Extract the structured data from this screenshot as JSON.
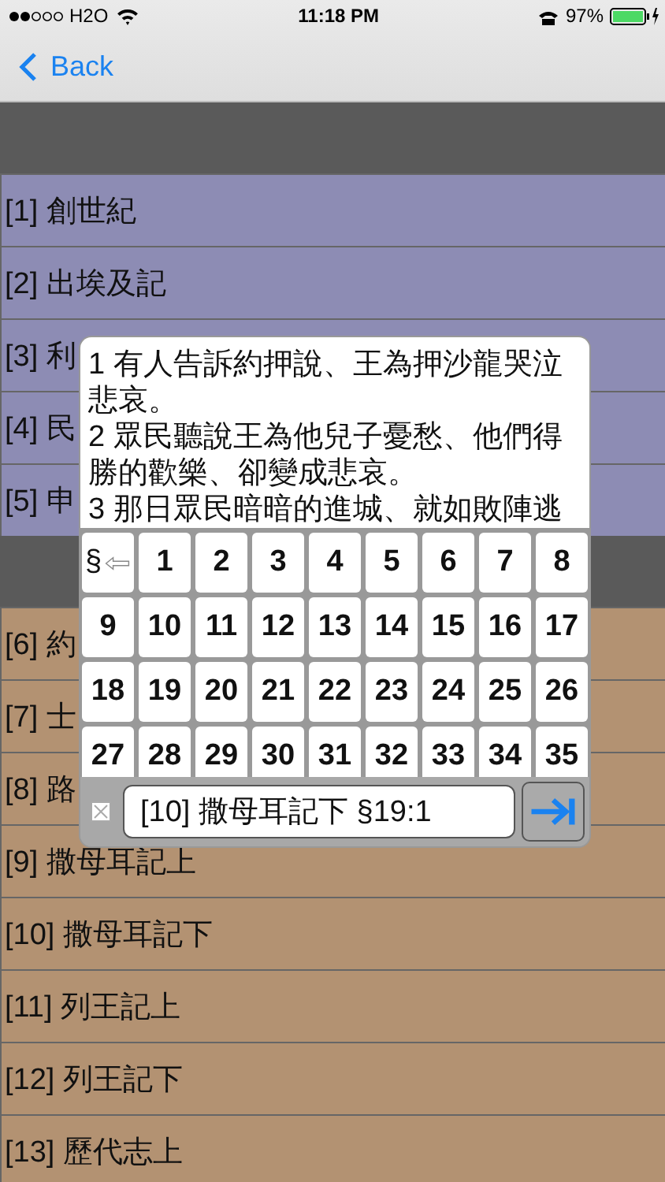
{
  "status_bar": {
    "carrier": "H2O",
    "time": "11:18 PM",
    "battery_text": "97%"
  },
  "nav": {
    "back": "Back"
  },
  "sections": [
    {
      "kind": "purple",
      "rows": [
        "[1] 創世紀",
        "[2] 出埃及記",
        "[3] 利",
        "[4] 民",
        "[5] 申"
      ]
    },
    {
      "kind": "brown",
      "rows": [
        "[6] 約",
        "[7] 士",
        "[8] 路",
        "[9] 撒母耳記上",
        "[10] 撒母耳記下",
        "[11] 列王記上",
        "[12] 列王記下",
        "[13] 歷代志上"
      ]
    }
  ],
  "popup": {
    "verses": [
      "1 有人告訴約押說、王為押沙龍哭泣悲哀。",
      "2 眾民聽說王為他兒子憂愁、他們得勝的歡樂、卻變成悲哀。",
      "3 那日眾民暗暗的進城、就如敗陣逃"
    ],
    "back_key": "§",
    "keys": [
      "1",
      "2",
      "3",
      "4",
      "5",
      "6",
      "7",
      "8",
      "9",
      "10",
      "11",
      "12",
      "13",
      "14",
      "15",
      "16",
      "17",
      "18",
      "19",
      "20",
      "21",
      "22",
      "23",
      "24",
      "25",
      "26",
      "27",
      "28",
      "29",
      "30",
      "31",
      "32",
      "33",
      "34",
      "35"
    ],
    "field_value": "[10] 撒母耳記下 §19:1"
  }
}
